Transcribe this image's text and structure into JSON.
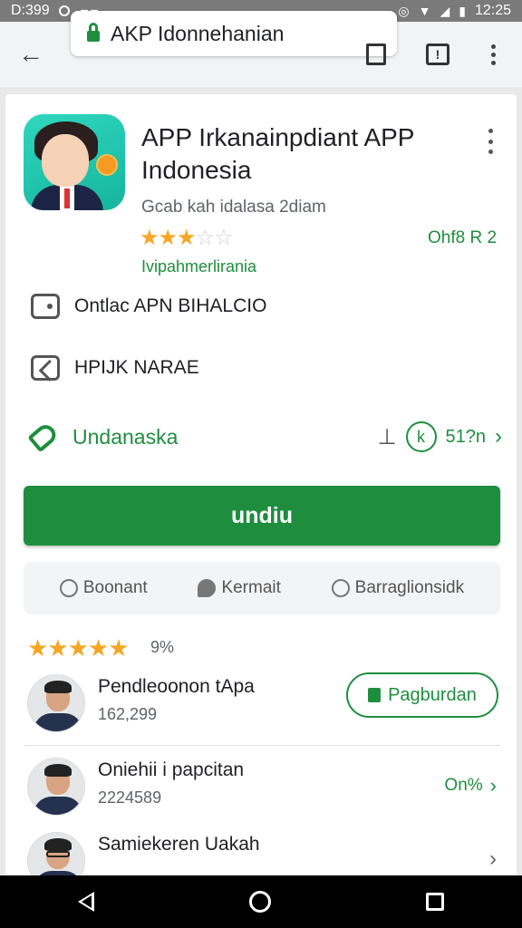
{
  "status_bar": {
    "left_text": "D:399",
    "time": "12:25"
  },
  "browser": {
    "url": "AKP Idonnehanian"
  },
  "app": {
    "title": "APP Irkanainpdiant APP Indonesia",
    "developer": "Gcab kah idalasa 2diam",
    "rating_stars": 3,
    "side_value": "Ohf8 R 2",
    "category": "Ivipahmerlirania"
  },
  "info": {
    "row1": "Ontlac APN BIHALCIO",
    "row2": "HPIJK NARAE"
  },
  "tag": {
    "label": "Undanaska",
    "circle_label": "k",
    "size": "51?n"
  },
  "install": {
    "label": "undiu"
  },
  "pills": [
    {
      "label": "Boonant",
      "icon": "location-pin-icon"
    },
    {
      "label": "Kermait",
      "icon": "chat-bubble-icon"
    },
    {
      "label": "Barraglionsidk",
      "icon": "circle-icon"
    }
  ],
  "reviews": {
    "stars": 5,
    "percent": "9%"
  },
  "people": [
    {
      "name": "Pendleoonon tApa",
      "count": "162,299",
      "button_label": "Pagburdan"
    },
    {
      "name": "Oniehii i papcitan",
      "count": "2224589",
      "right_label": "On%"
    },
    {
      "name": "Samiekeren Uakah"
    }
  ],
  "colors": {
    "accent": "#1e8e3e",
    "star": "#f5a623"
  }
}
